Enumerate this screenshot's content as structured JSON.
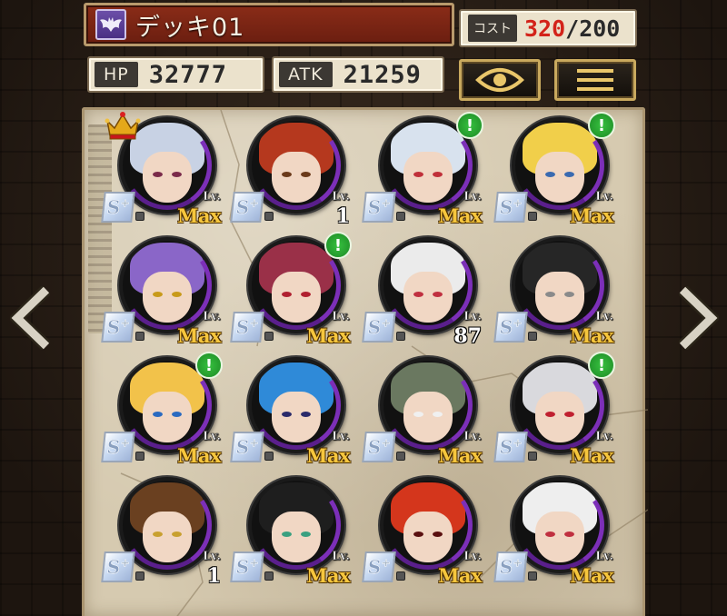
{
  "deck": {
    "name": "デッキ01"
  },
  "cost": {
    "label": "コスト",
    "current": "320",
    "max": "/200"
  },
  "stats": {
    "hp_label": "HP",
    "hp_value": "32777",
    "atk_label": "ATK",
    "atk_value": "21259"
  },
  "icons": {
    "deck": "bat-icon",
    "view": "eye-icon",
    "menu": "list-icon",
    "prev": "chevron-left-icon",
    "next": "chevron-right-icon",
    "leader": "crown-icon",
    "alert": "exclamation-icon",
    "rank": "rank-s-plus-badge",
    "lock": "lock-icon"
  },
  "rank_badge": "S+",
  "level_label": "Lv.",
  "colors": {
    "rank_purple": "#7c2fb8",
    "max_gold": "#f6c63d",
    "alert_green": "#2aa832",
    "cost_over": "#d3231a"
  },
  "cards": [
    {
      "level": "Max",
      "leader": true,
      "alert": false,
      "hair": "#c8d2e4",
      "eye": "#7a2a4a"
    },
    {
      "level": "1",
      "leader": false,
      "alert": false,
      "hair": "#b5381e",
      "eye": "#6b3a1a"
    },
    {
      "level": "Max",
      "leader": false,
      "alert": true,
      "hair": "#d8e2ee",
      "eye": "#c0303a"
    },
    {
      "level": "Max",
      "leader": false,
      "alert": true,
      "hair": "#f1cf4a",
      "eye": "#3a6ab0"
    },
    {
      "level": "Max",
      "leader": false,
      "alert": false,
      "hair": "#8a66c8",
      "eye": "#c89a1a"
    },
    {
      "level": "Max",
      "leader": false,
      "alert": true,
      "hair": "#9a3048",
      "eye": "#b02030"
    },
    {
      "level": "87",
      "leader": false,
      "alert": false,
      "hair": "#ebebeb",
      "eye": "#c03040"
    },
    {
      "level": "Max",
      "leader": false,
      "alert": false,
      "hair": "#262626",
      "eye": "#8a8a8a"
    },
    {
      "level": "Max",
      "leader": false,
      "alert": true,
      "hair": "#f2c24a",
      "eye": "#2a6ac0"
    },
    {
      "level": "Max",
      "leader": false,
      "alert": false,
      "hair": "#2f8ad8",
      "eye": "#2a2a6a"
    },
    {
      "level": "Max",
      "leader": false,
      "alert": false,
      "hair": "#6a7860",
      "eye": "#f0f0f0"
    },
    {
      "level": "Max",
      "leader": false,
      "alert": true,
      "hair": "#d9d9dd",
      "eye": "#c02030"
    },
    {
      "level": "1",
      "leader": false,
      "alert": false,
      "hair": "#6a4020",
      "eye": "#c8a030"
    },
    {
      "level": "Max",
      "leader": false,
      "alert": false,
      "hair": "#1e1e1e",
      "eye": "#3aa080"
    },
    {
      "level": "Max",
      "leader": false,
      "alert": false,
      "hair": "#d4361c",
      "eye": "#5a1010"
    },
    {
      "level": "Max",
      "leader": false,
      "alert": false,
      "hair": "#eeeeee",
      "eye": "#c03040"
    }
  ]
}
